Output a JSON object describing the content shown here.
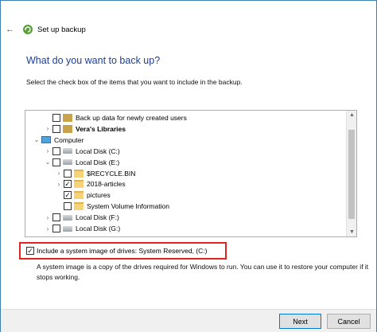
{
  "window": {
    "title": "Set up backup",
    "back_icon": "back-arrow-icon",
    "app_icon": "backup-icon"
  },
  "page": {
    "heading": "What do you want to back up?",
    "instruction": "Select the check box of the items that you want to include in the backup."
  },
  "tree": {
    "rows": [
      {
        "label": "Back up data for newly created users",
        "expander": "",
        "checked": false,
        "icon": "library",
        "bold": false,
        "indent": 1
      },
      {
        "label": "Vera's Libraries",
        "expander": "›",
        "checked": false,
        "icon": "library",
        "bold": true,
        "indent": 1
      },
      {
        "label": "Computer",
        "expander": "⌄",
        "checked": null,
        "icon": "computer",
        "bold": false,
        "indent": 0
      },
      {
        "label": "Local Disk (C:)",
        "expander": "›",
        "checked": false,
        "icon": "drive",
        "bold": false,
        "indent": 1
      },
      {
        "label": "Local Disk (E:)",
        "expander": "⌄",
        "checked": false,
        "icon": "drive",
        "bold": false,
        "indent": 1
      },
      {
        "label": "$RECYCLE.BIN",
        "expander": "›",
        "checked": false,
        "icon": "folder",
        "bold": false,
        "indent": 2
      },
      {
        "label": "2018-articles",
        "expander": "›",
        "checked": true,
        "icon": "folder",
        "bold": false,
        "indent": 2
      },
      {
        "label": "pictures",
        "expander": "",
        "checked": true,
        "icon": "folder",
        "bold": false,
        "indent": 2
      },
      {
        "label": "System Volume Information",
        "expander": "",
        "checked": false,
        "icon": "folder",
        "bold": false,
        "indent": 2
      },
      {
        "label": "Local Disk (F:)",
        "expander": "›",
        "checked": false,
        "icon": "drive",
        "bold": false,
        "indent": 1
      },
      {
        "label": "Local Disk (G:)",
        "expander": "›",
        "checked": false,
        "icon": "drive",
        "bold": false,
        "indent": 1
      }
    ]
  },
  "system_image": {
    "label": "Include a system image of drives: System Reserved, (C:)",
    "checked": true
  },
  "description": "A system image is a copy of the drives required for Windows to run. You can use it to restore your computer if it stops working.",
  "buttons": {
    "next": "Next",
    "cancel": "Cancel"
  }
}
